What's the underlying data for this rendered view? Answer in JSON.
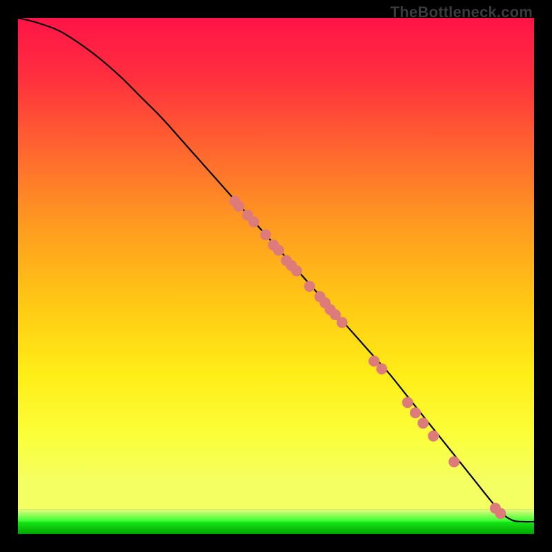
{
  "watermark": "TheBottleneck.com",
  "chart_data": {
    "type": "line",
    "title": "",
    "xlabel": "",
    "ylabel": "",
    "xlim": [
      0,
      100
    ],
    "ylim": [
      0,
      100
    ],
    "grid": false,
    "legend": false,
    "curve": {
      "name": "bottleneck-curve",
      "x": [
        0,
        4,
        8,
        12,
        16,
        20,
        24,
        28,
        32,
        36,
        40,
        44,
        48,
        52,
        56,
        60,
        64,
        68,
        72,
        76,
        80,
        84,
        88,
        92,
        94,
        96,
        98,
        100
      ],
      "y": [
        100,
        99,
        97.5,
        95,
        92,
        88.5,
        84.5,
        80.5,
        76,
        71.5,
        67,
        62.5,
        58,
        53.5,
        49,
        44.5,
        40,
        35.5,
        31,
        26,
        21,
        16,
        11,
        6,
        3.8,
        2.6,
        2.4,
        2.4
      ]
    },
    "points": {
      "name": "sample-points",
      "color": "#dc7b79",
      "xy": [
        [
          42,
          64.5
        ],
        [
          42.8,
          63.5
        ],
        [
          44.5,
          61.8
        ],
        [
          45.7,
          60.5
        ],
        [
          48.0,
          58.0
        ],
        [
          49.5,
          56.0
        ],
        [
          50.5,
          55.0
        ],
        [
          52.0,
          53.0
        ],
        [
          53.0,
          52.0
        ],
        [
          54.0,
          51.0
        ],
        [
          56.5,
          48.0
        ],
        [
          58.5,
          46.0
        ],
        [
          59.5,
          44.8
        ],
        [
          60.5,
          43.5
        ],
        [
          61.5,
          42.5
        ],
        [
          62.8,
          41.0
        ],
        [
          69.0,
          33.5
        ],
        [
          70.5,
          32.0
        ],
        [
          75.5,
          25.5
        ],
        [
          77.0,
          23.5
        ],
        [
          78.5,
          21.5
        ],
        [
          80.5,
          19.0
        ],
        [
          84.5,
          14.0
        ],
        [
          92.5,
          5.0
        ],
        [
          93.5,
          4.0
        ]
      ]
    },
    "bands": [
      {
        "name": "green-band-1",
        "y0": 2.4,
        "y1": 4.8,
        "gradient": [
          "#e8fd80",
          "#2dff2d"
        ]
      },
      {
        "name": "green-band-2",
        "y0": 0.0,
        "y1": 2.4,
        "gradient": [
          "#17e817",
          "#00a400"
        ]
      }
    ],
    "background_gradient": {
      "stops": [
        {
          "t": 0.0,
          "color": "#ff1448"
        },
        {
          "t": 0.12,
          "color": "#ff2f3e"
        },
        {
          "t": 0.28,
          "color": "#ff6a2e"
        },
        {
          "t": 0.42,
          "color": "#ff9a20"
        },
        {
          "t": 0.58,
          "color": "#ffc814"
        },
        {
          "t": 0.72,
          "color": "#ffec16"
        },
        {
          "t": 0.85,
          "color": "#fbff3a"
        },
        {
          "t": 0.945,
          "color": "#f4ff62"
        }
      ]
    }
  }
}
